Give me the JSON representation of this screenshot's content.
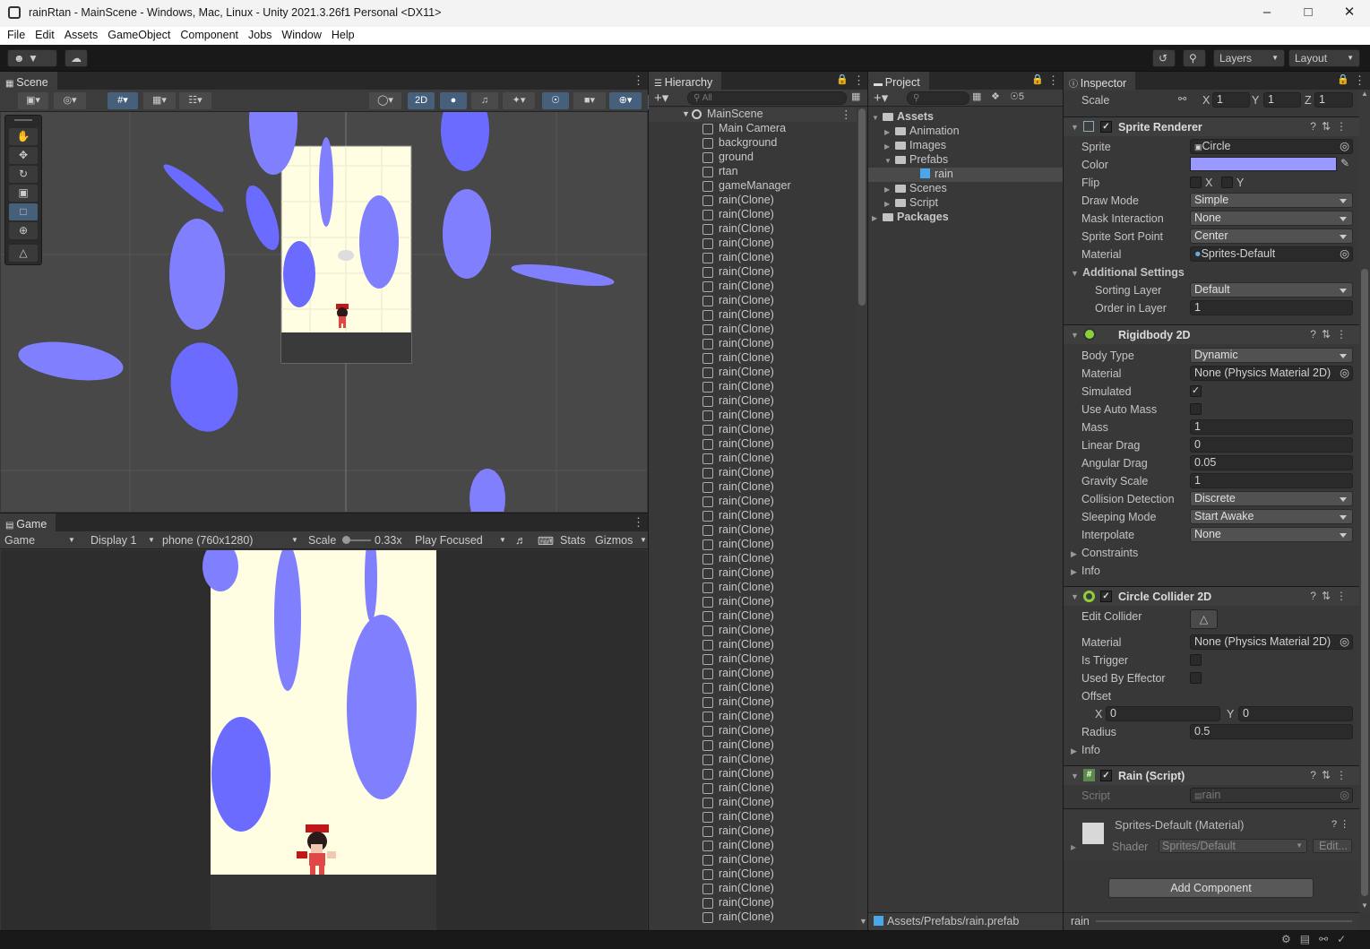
{
  "window": {
    "title": "rainRtan - MainScene - Windows, Mac, Linux - Unity 2021.3.26f1 Personal <DX11>"
  },
  "menu": [
    "File",
    "Edit",
    "Assets",
    "GameObject",
    "Component",
    "Jobs",
    "Window",
    "Help"
  ],
  "toolbar": {
    "layers_label": "Layers",
    "layout_label": "Layout"
  },
  "scene": {
    "tab": "Scene",
    "mode_2d": "2D"
  },
  "game": {
    "tab": "Game",
    "view_select": "Game",
    "display": "Display 1",
    "resolution": "phone (760x1280)",
    "scale_label": "Scale",
    "scale_value": "0.33x",
    "play_focused": "Play Focused",
    "stats": "Stats",
    "gizmos": "Gizmos"
  },
  "hierarchy": {
    "tab": "Hierarchy",
    "search_placeholder": "All",
    "scene_name": "MainScene",
    "items": [
      "Main Camera",
      "background",
      "ground",
      "rtan",
      "gameManager"
    ],
    "clone_label": "rain(Clone)",
    "clone_count": 51
  },
  "project": {
    "tab": "Project",
    "tree": [
      {
        "label": "Assets",
        "level": 0,
        "bold": true
      },
      {
        "label": "Animation",
        "level": 1
      },
      {
        "label": "Images",
        "level": 1
      },
      {
        "label": "Prefabs",
        "level": 1
      },
      {
        "label": "rain",
        "level": 2,
        "prefab": true
      },
      {
        "label": "Scenes",
        "level": 1
      },
      {
        "label": "Script",
        "level": 1
      },
      {
        "label": "Packages",
        "level": 0,
        "bold": true
      }
    ],
    "hidden_count": "5",
    "footer_path": "Assets/Prefabs/rain.prefab"
  },
  "inspector": {
    "tab": "Inspector",
    "scale": {
      "label": "Scale",
      "x_label": "X",
      "x": "1",
      "y_label": "Y",
      "y": "1",
      "z_label": "Z",
      "z": "1"
    },
    "sprite_renderer": {
      "title": "Sprite Renderer",
      "sprite_label": "Sprite",
      "sprite": "Circle",
      "color_label": "Color",
      "color": "#9999ff",
      "flip_label": "Flip",
      "flip_x": "X",
      "flip_y": "Y",
      "draw_mode_label": "Draw Mode",
      "draw_mode": "Simple",
      "mask_label": "Mask Interaction",
      "mask": "None",
      "sort_point_label": "Sprite Sort Point",
      "sort_point": "Center",
      "material_label": "Material",
      "material": "Sprites-Default",
      "additional_label": "Additional Settings",
      "sorting_layer_label": "Sorting Layer",
      "sorting_layer": "Default",
      "order_label": "Order in Layer",
      "order": "1"
    },
    "rigidbody": {
      "title": "Rigidbody 2D",
      "body_type_label": "Body Type",
      "body_type": "Dynamic",
      "material_label": "Material",
      "material": "None (Physics Material 2D)",
      "simulated_label": "Simulated",
      "auto_mass_label": "Use Auto Mass",
      "mass_label": "Mass",
      "mass": "1",
      "linear_drag_label": "Linear Drag",
      "linear_drag": "0",
      "angular_drag_label": "Angular Drag",
      "angular_drag": "0.05",
      "gravity_label": "Gravity Scale",
      "gravity": "1",
      "collision_label": "Collision Detection",
      "collision": "Discrete",
      "sleeping_label": "Sleeping Mode",
      "sleeping": "Start Awake",
      "interpolate_label": "Interpolate",
      "interpolate": "None",
      "constraints_label": "Constraints",
      "info_label": "Info"
    },
    "circle_collider": {
      "title": "Circle Collider 2D",
      "edit_label": "Edit Collider",
      "material_label": "Material",
      "material": "None (Physics Material 2D)",
      "trigger_label": "Is Trigger",
      "effector_label": "Used By Effector",
      "offset_label": "Offset",
      "offset_x_label": "X",
      "offset_x": "0",
      "offset_y_label": "Y",
      "offset_y": "0",
      "radius_label": "Radius",
      "radius": "0.5",
      "info_label": "Info"
    },
    "rain_script": {
      "title": "Rain (Script)",
      "script_label": "Script",
      "script": "rain"
    },
    "material": {
      "name": "Sprites-Default (Material)",
      "shader_label": "Shader",
      "shader": "Sprites/Default",
      "edit": "Edit..."
    },
    "add_component": "Add Component",
    "footer": "rain"
  }
}
